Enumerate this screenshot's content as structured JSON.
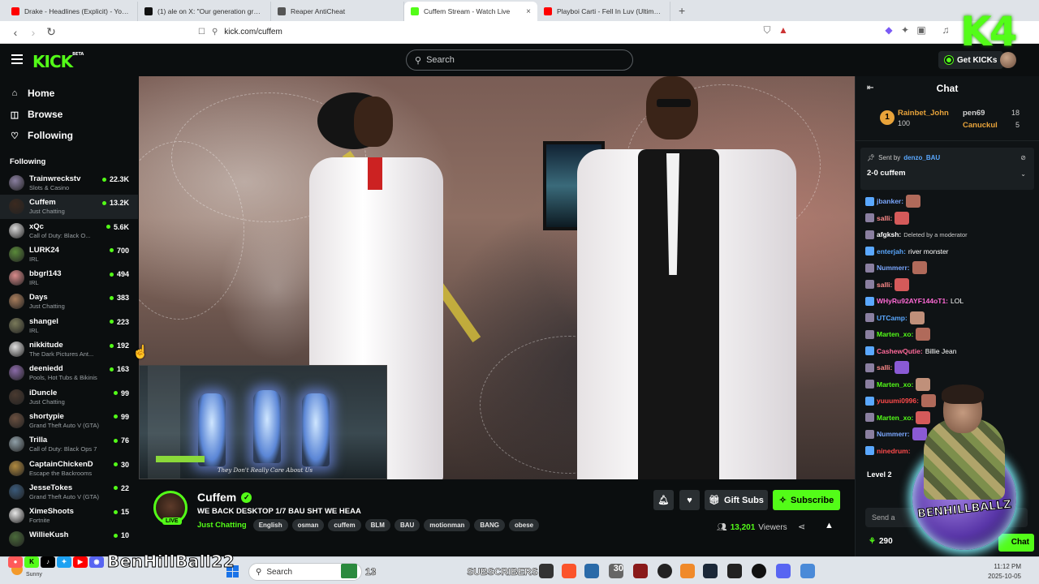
{
  "browser": {
    "tabs": [
      {
        "title": "Drake - Headlines (Explicit) - YouTub",
        "color": "#ff0000"
      },
      {
        "title": "(1) ale on X: \"Our generation greate",
        "color": "#111111"
      },
      {
        "title": "Reaper AntiCheat",
        "color": "#555555"
      },
      {
        "title": "Cuffem Stream - Watch Live",
        "color": "#53fc18",
        "active": true
      },
      {
        "title": "Playboi Carti - Fell In Luv (Ultimate M",
        "color": "#ff0000"
      }
    ],
    "url": "kick.com/cuffem"
  },
  "header": {
    "logo": "KICK",
    "logo_tag": "BETA",
    "search_placeholder": "Search",
    "get_kicks": "Get KICKs"
  },
  "sidebar": {
    "nav": [
      {
        "label": "Home",
        "icon": "home-icon",
        "glyph": "⌂"
      },
      {
        "label": "Browse",
        "icon": "browse-icon",
        "glyph": "◫"
      },
      {
        "label": "Following",
        "icon": "heart-icon",
        "glyph": "♡"
      }
    ],
    "following_title": "Following",
    "following": [
      {
        "name": "Trainwreckstv",
        "category": "Slots & Casino",
        "viewers": "22.3K",
        "color": "#8a7fa0"
      },
      {
        "name": "Cuffem",
        "category": "Just Chatting",
        "viewers": "13.2K",
        "color": "#3b2a20"
      },
      {
        "name": "xQc",
        "category": "Call of Duty: Black O...",
        "viewers": "5.6K",
        "color": "#d8d8d8"
      },
      {
        "name": "LURK24",
        "category": "IRL",
        "viewers": "700",
        "color": "#5a8a3a"
      },
      {
        "name": "bbgrl143",
        "category": "IRL",
        "viewers": "494",
        "color": "#d98b8b"
      },
      {
        "name": "Days",
        "category": "Just Chatting",
        "viewers": "383",
        "color": "#a87d5c"
      },
      {
        "name": "shangel",
        "category": "IRL",
        "viewers": "223",
        "color": "#7a7a5a"
      },
      {
        "name": "nikkitude",
        "category": "The Dark Pictures Ant...",
        "viewers": "192",
        "color": "#e0e0e0"
      },
      {
        "name": "deeniedd",
        "category": "Pools, Hot Tubs & Bikinis",
        "viewers": "163",
        "color": "#8a6aa8"
      },
      {
        "name": "iDuncle",
        "category": "Just Chatting",
        "viewers": "99",
        "color": "#4a3a30"
      },
      {
        "name": "shortypie",
        "category": "Grand Theft Auto V (GTA)",
        "viewers": "99",
        "color": "#6a5040"
      },
      {
        "name": "Trilla",
        "category": "Call of Duty: Black Ops 7",
        "viewers": "76",
        "color": "#90a0a8"
      },
      {
        "name": "CaptainChickenD",
        "category": "Escape the Backrooms",
        "viewers": "30",
        "color": "#b08a40"
      },
      {
        "name": "JesseTokes",
        "category": "Grand Theft Auto V (GTA)",
        "viewers": "22",
        "color": "#3a5a7a"
      },
      {
        "name": "XimeShoots",
        "category": "Fortnite",
        "viewers": "15",
        "color": "#e8e8e8"
      },
      {
        "name": "WillieKush",
        "category": "",
        "viewers": "10",
        "color": "#4a6a3a"
      }
    ]
  },
  "video": {
    "pip_caption": "They Don't Really Care About Us"
  },
  "stream": {
    "name": "Cuffem",
    "live_label": "LIVE",
    "title": "WE BACK DESKTOP 1/7 BAU SHT WE HEAA",
    "category": "Just Chatting",
    "tags": [
      "English",
      "osman",
      "cuffem",
      "BLM",
      "BAU",
      "motionman",
      "BANG",
      "obese"
    ],
    "gift_subs": "Gift Subs",
    "subscribe": "Subscribe",
    "viewers_count": "13,201",
    "viewers_label": "Viewers",
    "accent": "#53fc18"
  },
  "chat": {
    "title": "Chat",
    "leaderboard": [
      {
        "rank": "1",
        "name": "Rainbet_John",
        "value": "100",
        "color": "#e8a33a"
      },
      {
        "name": "pen69",
        "value": "18",
        "color": "#d0d0d0"
      },
      {
        "name": "Canuckul",
        "value": "5",
        "color": "#e8a33a"
      }
    ],
    "pinned": {
      "sent_by_label": "Sent by",
      "sender": "denzo_BAU",
      "message": "2-0 cuffem"
    },
    "messages": [
      {
        "user": "jbanker:",
        "text": "",
        "color": "#7aa7ff",
        "emote": true
      },
      {
        "user": "salli:",
        "text": "",
        "color": "#ff8a8a",
        "emote": true
      },
      {
        "user": "afgksh:",
        "text": "Deleted by a moderator",
        "color": "#ffffff",
        "emote": false
      },
      {
        "user": "enterjah:",
        "text": "river monster",
        "color": "#5aa8ff",
        "emote": false
      },
      {
        "user": "Nummerr:",
        "text": "",
        "color": "#7aa7ff",
        "emote": true
      },
      {
        "user": "salli:",
        "text": "",
        "color": "#ff8a8a",
        "emote": true
      },
      {
        "user": "WHyRu92AYF144oT1:",
        "text": "LOL",
        "color": "#ff6ad5",
        "emote": false
      },
      {
        "user": "UTCamp:",
        "text": "",
        "color": "#5aa8ff",
        "emote": true
      },
      {
        "user": "Marten_xo:",
        "text": "",
        "color": "#53fc18",
        "emote": true
      },
      {
        "user": "CashewQutie:",
        "text": "Billie Jean",
        "color": "#ff6a9a",
        "emote": false
      },
      {
        "user": "salli:",
        "text": "",
        "color": "#ff8a8a",
        "emote": true
      },
      {
        "user": "Marten_xo:",
        "text": "",
        "color": "#53fc18",
        "emote": true
      },
      {
        "user": "yuuumi0996:",
        "text": "",
        "color": "#ff4a4a",
        "emote": true
      },
      {
        "user": "Marten_xo:",
        "text": "",
        "color": "#53fc18",
        "emote": true
      },
      {
        "user": "Nummerr:",
        "text": "",
        "color": "#7aa7ff",
        "emote": true
      },
      {
        "user": "ninedrum:",
        "text": "",
        "color": "#ff4a4a",
        "emote": false
      }
    ],
    "level_label": "Level 2",
    "input_placeholder": "Send a",
    "points": "290",
    "send_label": "Chat"
  },
  "overlay": {
    "corner_logo": "K4",
    "username": "BenHillBall22",
    "cam_text": "BENHILLBALLZ"
  },
  "taskbar": {
    "weather": "Sunny",
    "search": "Search",
    "subs_count": "13",
    "subs_label": "SUBSCRIBERS",
    "badge": "30",
    "time": "11:12 PM",
    "date": "2025-10-05"
  }
}
